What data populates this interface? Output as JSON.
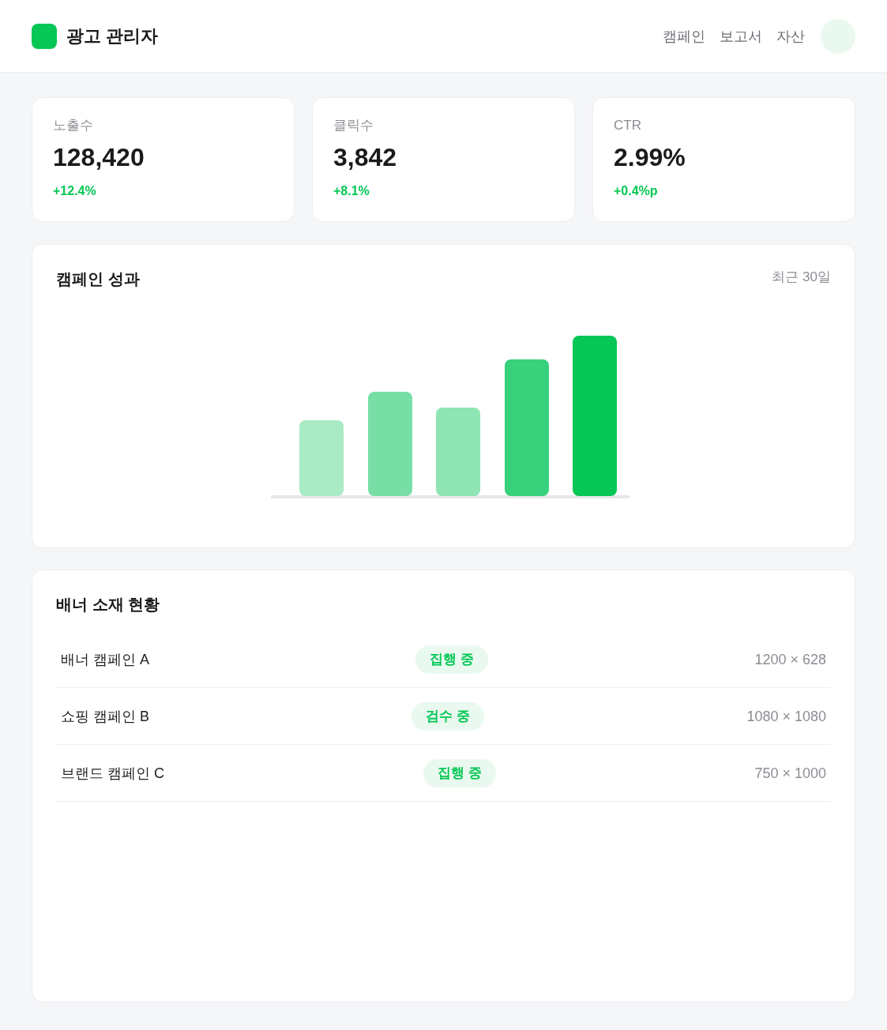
{
  "header": {
    "title": "광고 관리자",
    "nav": [
      "캠페인",
      "보고서",
      "자산"
    ]
  },
  "stats": [
    {
      "label": "노출수",
      "value": "128,420",
      "change": "+12.4%"
    },
    {
      "label": "클릭수",
      "value": "3,842",
      "change": "+8.1%"
    },
    {
      "label": "CTR",
      "value": "2.99%",
      "change": "+0.4%p"
    }
  ],
  "performance": {
    "title": "캠페인 성과",
    "period": "최근 30일"
  },
  "banners": {
    "title": "배너 소재 현황",
    "rows": [
      {
        "name": "배너 캠페인 A",
        "status": "집행 중",
        "size": "1200 × 628"
      },
      {
        "name": "쇼핑 캠페인 B",
        "status": "검수 중",
        "size": "1080 × 1080"
      },
      {
        "name": "브랜드 캠페인 C",
        "status": "집행 중",
        "size": "750 × 1000"
      }
    ]
  }
}
